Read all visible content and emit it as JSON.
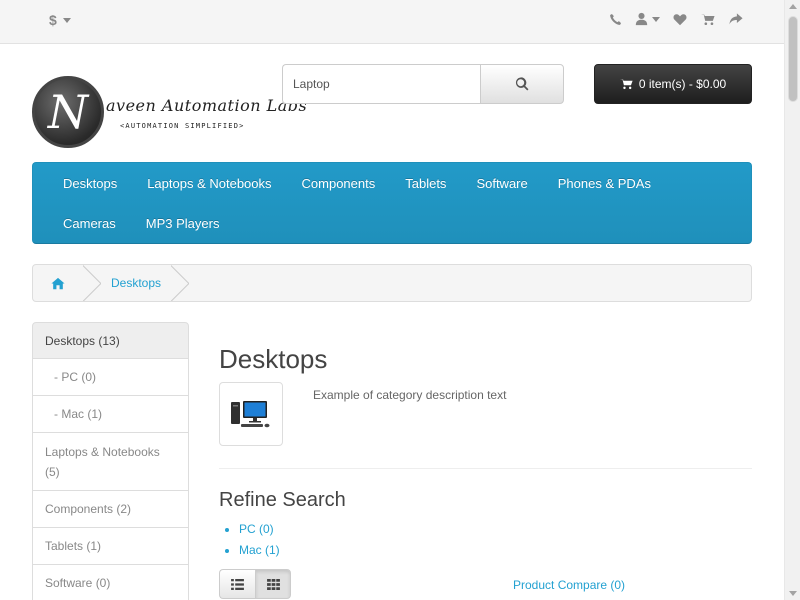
{
  "top": {
    "currency": "$",
    "icons": [
      "phone-icon",
      "user-icon",
      "heart-icon",
      "cart-icon",
      "share-icon"
    ]
  },
  "logo": {
    "letter": "N",
    "name": "aveen Automation Labs",
    "tagline": "<AUTOMATION SIMPLIFIED>"
  },
  "search": {
    "value": "Laptop",
    "placeholder": "Search"
  },
  "cart": {
    "label": "0 item(s) - $0.00"
  },
  "menu": {
    "items": [
      "Desktops",
      "Laptops & Notebooks",
      "Components",
      "Tablets",
      "Software",
      "Phones & PDAs",
      "Cameras",
      "MP3 Players"
    ]
  },
  "breadcrumb": {
    "items": [
      "Desktops"
    ]
  },
  "sidebar": {
    "items": [
      "Desktops (13)",
      "- PC (0)",
      "- Mac (1)",
      "Laptops & Notebooks (5)",
      "Components (2)",
      "Tablets (1)",
      "Software (0)"
    ]
  },
  "content": {
    "title": "Desktops",
    "description": "Example of category description text",
    "refine_title": "Refine Search",
    "refine_items": [
      "PC (0)",
      "Mac (1)"
    ],
    "compare": "Product Compare (0)"
  },
  "colors": {
    "accent": "#229ac8",
    "link": "#23a1d1",
    "cart_bg": "#303030"
  }
}
